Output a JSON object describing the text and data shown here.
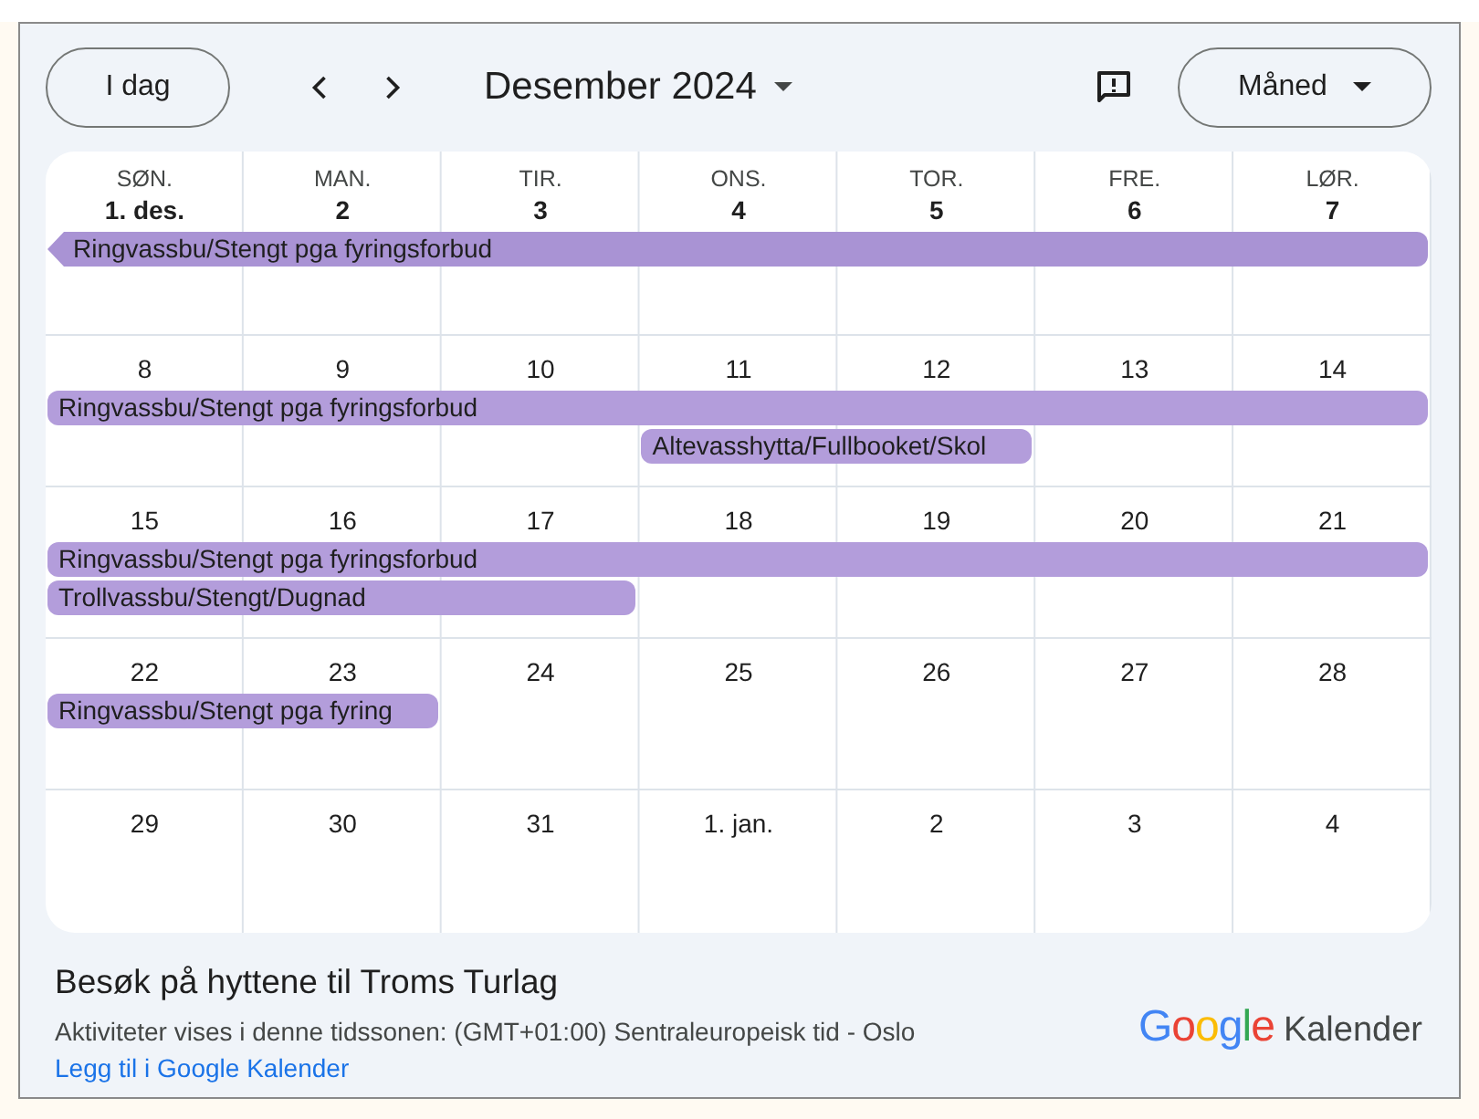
{
  "toolbar": {
    "today_button": "I dag",
    "month_title": "Desember 2024",
    "view_button": "Måned"
  },
  "weekdays": [
    "SØN.",
    "MAN.",
    "TIR.",
    "ONS.",
    "TOR.",
    "FRE.",
    "LØR."
  ],
  "weeks": [
    {
      "days": [
        "1. des.",
        "2",
        "3",
        "4",
        "5",
        "6",
        "7"
      ],
      "events": [
        {
          "title": "Ringvassbu/Stengt pga fyringsforbud",
          "covers": [
            true,
            true,
            true,
            true,
            true,
            true,
            true
          ],
          "continues_before": true
        }
      ]
    },
    {
      "days": [
        "8",
        "9",
        "10",
        "11",
        "12",
        "13",
        "14"
      ],
      "events": [
        {
          "title": "Ringvassbu/Stengt pga fyringsforbud",
          "covers": [
            true,
            true,
            true,
            true,
            true,
            true,
            true
          ],
          "continues_before": false
        },
        {
          "title": "Altevasshytta/Fullbooket/Skol",
          "covers": [
            false,
            false,
            false,
            true,
            true,
            false,
            false
          ],
          "continues_before": false
        }
      ]
    },
    {
      "days": [
        "15",
        "16",
        "17",
        "18",
        "19",
        "20",
        "21"
      ],
      "events": [
        {
          "title": "Ringvassbu/Stengt pga fyringsforbud",
          "covers": [
            true,
            true,
            true,
            true,
            true,
            true,
            true
          ],
          "continues_before": false
        },
        {
          "title": "Trollvassbu/Stengt/Dugnad",
          "covers": [
            true,
            true,
            true,
            false,
            false,
            false,
            false
          ],
          "continues_before": false
        }
      ]
    },
    {
      "days": [
        "22",
        "23",
        "24",
        "25",
        "26",
        "27",
        "28"
      ],
      "events": [
        {
          "title": "Ringvassbu/Stengt pga fyring",
          "covers": [
            true,
            true,
            false,
            false,
            false,
            false,
            false
          ],
          "continues_before": false
        }
      ]
    },
    {
      "days": [
        "29",
        "30",
        "31",
        "1. jan.",
        "2",
        "3",
        "4"
      ]
    }
  ],
  "footer": {
    "title": "Besøk på hyttene til Troms Turlag",
    "timezone_note": "Aktiviteter vises i denne tidssonen: (GMT+01:00) Sentraleuropeisk tid - Oslo",
    "link": "Legg til i Google Kalender",
    "logo": "Google",
    "logo_suffix": "Kalender"
  }
}
